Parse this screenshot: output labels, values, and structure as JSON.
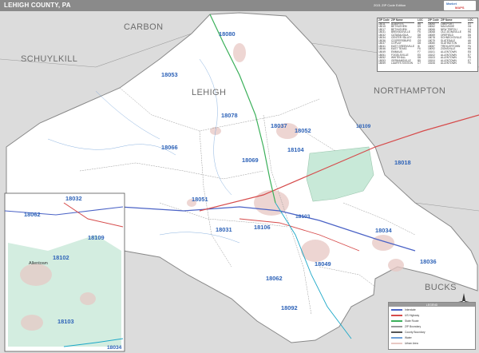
{
  "header": {
    "title": "LEHIGH COUNTY, PA",
    "edition": "2021 ZIP Code Edition",
    "logo_line1": "Market",
    "logo_line2": "MAPS"
  },
  "counties": {
    "carbon": "CARBON",
    "schuylkill": "SCHUYLKILL",
    "lehigh": "LEHIGH",
    "northampton": "NORTHAMPTON",
    "bucks": "BUCKS"
  },
  "zips": {
    "z18080": "18080",
    "z18053": "18053",
    "z18078": "18078",
    "z18037": "18037",
    "z18052": "18052",
    "z18109a": "18109",
    "z18066": "18066",
    "z18104": "18104",
    "z18069": "18069",
    "z18018": "18018",
    "z18051": "18051",
    "z18103a": "18103",
    "z18031": "18031",
    "z18106": "18106",
    "z18034": "18034",
    "z18049": "18049",
    "z18036": "18036",
    "z18062": "18062",
    "z18092": "18092",
    "inset_18032": "18032",
    "inset_18062": "18062",
    "inset_18109": "18109",
    "inset_18102": "18102",
    "inset_18103": "18103",
    "inset_18034": "18034"
  },
  "inset": {
    "city_label": "Allentown"
  },
  "zip_table": {
    "col1_header": "ZIP Code",
    "col2_header": "ZIP Name",
    "col3_header": "LOC",
    "col4_header": "ZIP Code",
    "col5_header": "ZIP Name",
    "col6_header": "LOC",
    "rows_left": [
      [
        "18011",
        "ALBURTIS",
        "H6"
      ],
      [
        "18015",
        "BETHLEHEM",
        "D9"
      ],
      [
        "18017",
        "BETHLEHEM",
        "C9"
      ],
      [
        "18031",
        "BREINIGSVILLE",
        "F5"
      ],
      [
        "18032",
        "CATASAUQUA",
        "D8"
      ],
      [
        "18034",
        "CENTER VALLEY",
        "E8"
      ],
      [
        "18036",
        "COOPERSBURG",
        "G9"
      ],
      [
        "18037",
        "COPLAY",
        "D8"
      ],
      [
        "18041",
        "EAST GREENVILLE",
        "I6"
      ],
      [
        "18046",
        "EAST TEXAS",
        "F6"
      ],
      [
        "18049",
        "EMMAUS",
        "F7"
      ],
      [
        "18051",
        "FOGELSVILLE",
        "E5"
      ],
      [
        "18052",
        "WHITEHALL",
        "D8"
      ],
      [
        "18053",
        "GERMANSVILLE",
        "B5"
      ],
      [
        "18059",
        "LAURYS STATION",
        "C7"
      ]
    ],
    "rows_right": [
      [
        "18060",
        "LIMEPORT",
        "G7"
      ],
      [
        "18062",
        "MACUNGIE",
        "G6"
      ],
      [
        "18066",
        "NEW TRIPOLI",
        "C4"
      ],
      [
        "18068",
        "OLD ZIONSVILLE",
        "H6"
      ],
      [
        "18069",
        "OREFIELD",
        "D6"
      ],
      [
        "18078",
        "SCHNECKSVILLE",
        "C6"
      ],
      [
        "18079",
        "SLATEDALE",
        "A6"
      ],
      [
        "18080",
        "SLATINGTON",
        "A6"
      ],
      [
        "18087",
        "TREXLERTOWN",
        "F6"
      ],
      [
        "18092",
        "ZIONSVILLE",
        "H6"
      ],
      [
        "18101",
        "ALLENTOWN",
        "E8"
      ],
      [
        "18102",
        "ALLENTOWN",
        "E7"
      ],
      [
        "18103",
        "ALLENTOWN",
        "F8"
      ],
      [
        "18104",
        "ALLENTOWN",
        "E7"
      ],
      [
        "18106",
        "ALLENTOWN",
        "F6"
      ]
    ]
  },
  "legend": {
    "title": "LEGEND",
    "items": [
      "Interstate",
      "US Highway",
      "State Route",
      "ZIP Boundary",
      "County Boundary",
      "Water",
      "Urban Area"
    ]
  },
  "compass": {
    "north": "N"
  },
  "colors": {
    "land": "#ffffff",
    "outside": "#dcdcdc",
    "zip_label": "#2e63b8",
    "highlight_zip": "#c8e9d8",
    "urban": "#e8c8c4",
    "interstate": "#4b63c6",
    "highway_red": "#d64b4b",
    "highway_green": "#3bb05a",
    "highway_cyan": "#1ba8c8"
  }
}
